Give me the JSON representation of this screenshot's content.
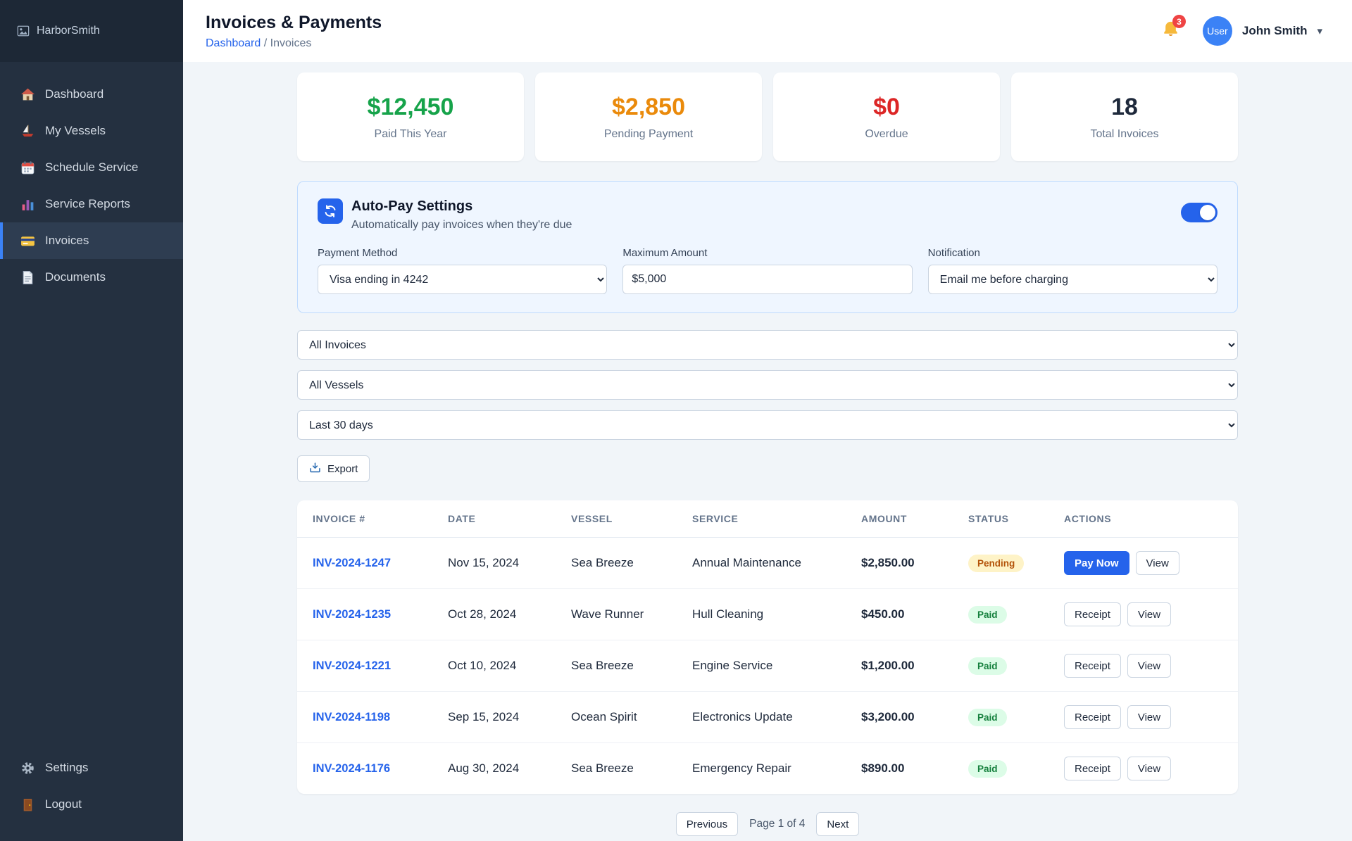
{
  "colors": {
    "accent": "#2563eb",
    "paid_green": "#16a34a",
    "pending_orange": "#ea8a0b",
    "overdue_red": "#dc2626",
    "sidebar_bg": "#243040",
    "pending_badge_bg": "#fef3c7",
    "paid_badge_bg": "#dcfce7"
  },
  "sidebar": {
    "logo_alt": "HarborSmith",
    "items": [
      {
        "label": "Dashboard",
        "icon": "home-icon"
      },
      {
        "label": "My Vessels",
        "icon": "sailboat-icon"
      },
      {
        "label": "Schedule Service",
        "icon": "calendar-icon"
      },
      {
        "label": "Service Reports",
        "icon": "bar-chart-icon"
      },
      {
        "label": "Invoices",
        "icon": "credit-card-icon",
        "active": true
      },
      {
        "label": "Documents",
        "icon": "document-icon"
      }
    ],
    "footer_items": [
      {
        "label": "Settings",
        "icon": "gear-icon"
      },
      {
        "label": "Logout",
        "icon": "door-icon"
      }
    ]
  },
  "header": {
    "title": "Invoices & Payments",
    "breadcrumb": {
      "parent": "Dashboard",
      "separator": "/",
      "current": "Invoices"
    },
    "notification_count": "3",
    "avatar_alt": "User",
    "user_name": "John Smith"
  },
  "stats": [
    {
      "value": "$12,450",
      "label": "Paid This Year",
      "color": "#16a34a"
    },
    {
      "value": "$2,850",
      "label": "Pending Payment",
      "color": "#ea8a0b"
    },
    {
      "value": "$0",
      "label": "Overdue",
      "color": "#dc2626"
    },
    {
      "value": "18",
      "label": "Total Invoices",
      "color": "#1e293b"
    }
  ],
  "autopay": {
    "title": "Auto-Pay Settings",
    "subtitle": "Automatically pay invoices when they're due",
    "enabled": true,
    "fields": [
      {
        "label": "Payment Method",
        "value": "Visa ending in 4242",
        "type": "select"
      },
      {
        "label": "Maximum Amount",
        "value": "$5,000",
        "type": "input"
      },
      {
        "label": "Notification",
        "value": "Email me before charging",
        "type": "select"
      }
    ]
  },
  "filters": {
    "invoice_filter": "All Invoices",
    "vessel_filter": "All Vessels",
    "date_filter": "Last 30 days",
    "export_label": "Export"
  },
  "table": {
    "columns": [
      "INVOICE #",
      "DATE",
      "VESSEL",
      "SERVICE",
      "AMOUNT",
      "STATUS",
      "ACTIONS"
    ],
    "rows": [
      {
        "invoice": "INV-2024-1247",
        "date": "Nov 15, 2024",
        "vessel": "Sea Breeze",
        "service": "Annual Maintenance",
        "amount": "$2,850.00",
        "status": "Pending",
        "actions": [
          "Pay Now",
          "View"
        ]
      },
      {
        "invoice": "INV-2024-1235",
        "date": "Oct 28, 2024",
        "vessel": "Wave Runner",
        "service": "Hull Cleaning",
        "amount": "$450.00",
        "status": "Paid",
        "actions": [
          "Receipt",
          "View"
        ]
      },
      {
        "invoice": "INV-2024-1221",
        "date": "Oct 10, 2024",
        "vessel": "Sea Breeze",
        "service": "Engine Service",
        "amount": "$1,200.00",
        "status": "Paid",
        "actions": [
          "Receipt",
          "View"
        ]
      },
      {
        "invoice": "INV-2024-1198",
        "date": "Sep 15, 2024",
        "vessel": "Ocean Spirit",
        "service": "Electronics Update",
        "amount": "$3,200.00",
        "status": "Paid",
        "actions": [
          "Receipt",
          "View"
        ]
      },
      {
        "invoice": "INV-2024-1176",
        "date": "Aug 30, 2024",
        "vessel": "Sea Breeze",
        "service": "Emergency Repair",
        "amount": "$890.00",
        "status": "Paid",
        "actions": [
          "Receipt",
          "View"
        ]
      }
    ]
  },
  "pagination": {
    "previous": "Previous",
    "status": "Page 1 of 4",
    "next": "Next"
  }
}
